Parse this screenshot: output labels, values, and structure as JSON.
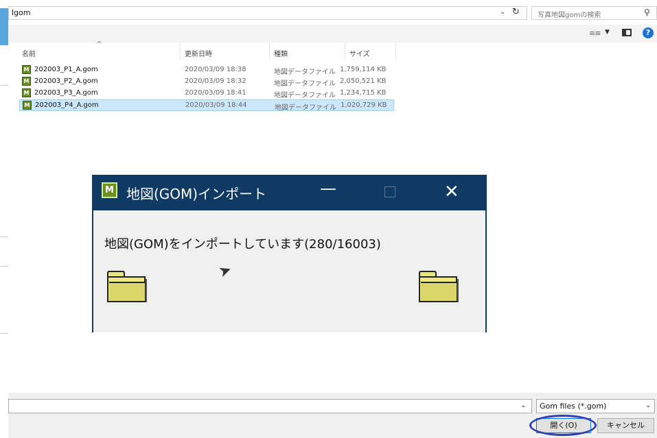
{
  "address_bar": {
    "path": "lgom",
    "search_placeholder": "写真地図gomの検索"
  },
  "toolbar": {
    "help_label": "?"
  },
  "file_list": {
    "columns": [
      "名前",
      "更新日時",
      "種類",
      "サイズ"
    ],
    "rows": [
      {
        "name": "202003_P1_A.gom",
        "date": "2020/03/09 18:38",
        "type": "地図データファイル",
        "size": "1,759,114 KB",
        "selected": false
      },
      {
        "name": "202003_P2_A.gom",
        "date": "2020/03/09 18:32",
        "type": "地図データファイル",
        "size": "2,050,521 KB",
        "selected": false
      },
      {
        "name": "202003_P3_A.gom",
        "date": "2020/03/09 18:41",
        "type": "地図データファイル",
        "size": "1,234,715 KB",
        "selected": false
      },
      {
        "name": "202003_P4_A.gom",
        "date": "2020/03/09 18:44",
        "type": "地図データファイル",
        "size": "1,020,729 KB",
        "selected": true
      }
    ]
  },
  "progress_dialog": {
    "title": "地図(GOM)インポート",
    "message": "地図(GOM)をインポートしています(280/16003)",
    "progress": {
      "current": 280,
      "total": 16003
    }
  },
  "footer": {
    "file_type": "Gom files (*.gom)",
    "open_button": "開く(O)",
    "cancel_button": "キャンセル"
  },
  "colors": {
    "dialog_title_bar": "#0f3a64",
    "selection": "#cce8ff",
    "highlight_circle": "#2e3fb8"
  }
}
